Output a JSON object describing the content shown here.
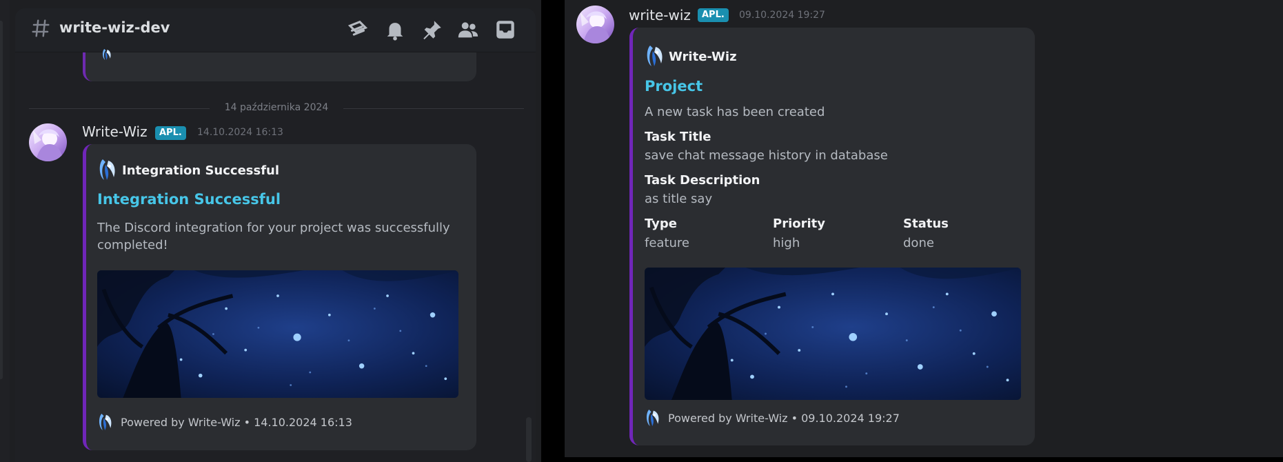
{
  "colors": {
    "accent_blurple": "#7026b9",
    "link_cyan": "#47c6e8",
    "badge_teal": "#1a8fb0"
  },
  "left": {
    "channel": {
      "name": "write-wiz-dev"
    },
    "header_icons": [
      "threads-icon",
      "bell-icon",
      "pin-icon",
      "members-icon",
      "inbox-icon"
    ],
    "date_divider": "14 października 2024",
    "message": {
      "author": "Write-Wiz",
      "badge": "APL.",
      "timestamp": "14.10.2024 16:13",
      "embed": {
        "author": "Integration Successful",
        "title": "Integration Successful",
        "description": "The Discord integration for your project was successfully completed!",
        "footer": "Powered by Write-Wiz • 14.10.2024 16:13"
      }
    }
  },
  "right": {
    "message": {
      "author": "write-wiz",
      "badge": "APL.",
      "timestamp": "09.10.2024 19:27",
      "embed": {
        "author": "Write-Wiz",
        "title": "Project",
        "description": "A new task has been created",
        "fields": [
          {
            "name": "Task Title",
            "value": "save chat message history in database"
          },
          {
            "name": "Task Description",
            "value": "as title say"
          },
          {
            "name": "Type",
            "value": "feature"
          },
          {
            "name": "Priority",
            "value": "high"
          },
          {
            "name": "Status",
            "value": "done"
          }
        ],
        "footer": "Powered by Write-Wiz • 09.10.2024 19:27"
      }
    }
  }
}
